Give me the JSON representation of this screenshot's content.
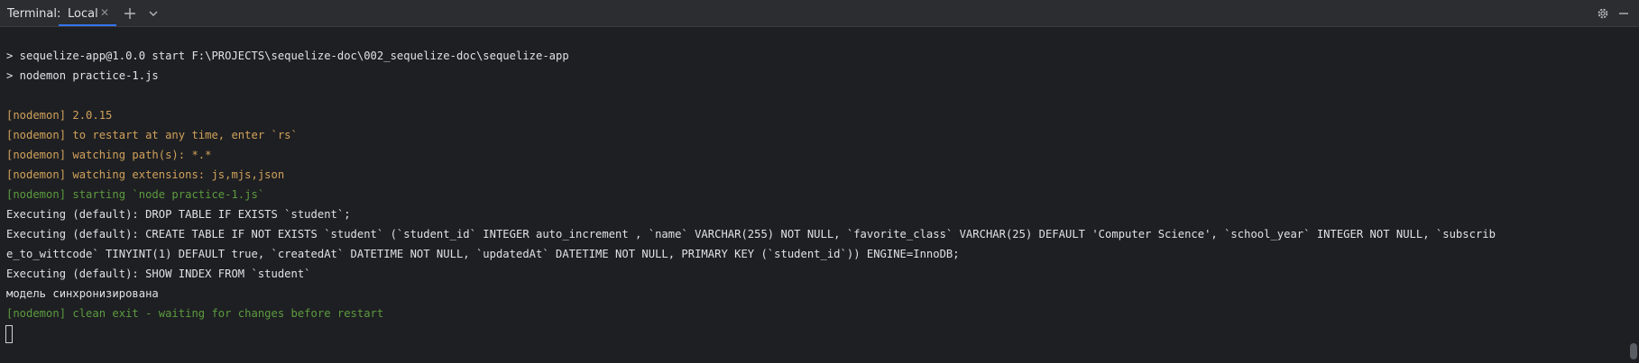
{
  "toolwindow": {
    "title": "Terminal:",
    "tab_label": "Local",
    "close_glyph": "✕",
    "icons": [
      "add-icon",
      "chevron-down-icon",
      "gear-icon",
      "minimize-icon"
    ]
  },
  "terminal": {
    "lines": [
      {
        "text": "> sequelize-app@1.0.0 start F:\\PROJECTS\\sequelize-doc\\002_sequelize-doc\\sequelize-app",
        "color": "default"
      },
      {
        "text": "> nodemon practice-1.js",
        "color": "default"
      },
      {
        "text": "[nodemon] 2.0.15",
        "color": "yellow"
      },
      {
        "text": "[nodemon] to restart at any time, enter `rs`",
        "color": "yellow"
      },
      {
        "text": "[nodemon] watching path(s): *.*",
        "color": "yellow"
      },
      {
        "text": "[nodemon] watching extensions: js,mjs,json",
        "color": "yellow"
      },
      {
        "text": "[nodemon] starting `node practice-1.js`",
        "color": "green"
      },
      {
        "text": "Executing (default): DROP TABLE IF EXISTS `student`;",
        "color": "default"
      },
      {
        "text": "Executing (default): CREATE TABLE IF NOT EXISTS `student` (`student_id` INTEGER auto_increment , `name` VARCHAR(255) NOT NULL, `favorite_class` VARCHAR(25) DEFAULT 'Computer Science', `school_year` INTEGER NOT NULL, `subscrib",
        "color": "default"
      },
      {
        "text": "e_to_wittcode` TINYINT(1) DEFAULT true, `createdAt` DATETIME NOT NULL, `updatedAt` DATETIME NOT NULL, PRIMARY KEY (`student_id`)) ENGINE=InnoDB;",
        "color": "default"
      },
      {
        "text": "Executing (default): SHOW INDEX FROM `student`",
        "color": "default"
      },
      {
        "text": "модель синхронизирована",
        "color": "default"
      },
      {
        "text": "[nodemon] clean exit - waiting for changes before restart",
        "color": "green"
      }
    ],
    "colors": {
      "default": "#dfe1e5",
      "yellow": "#d0a15b",
      "green": "#5c9b3f",
      "background": "#1e1f22",
      "accent": "#3574f0"
    }
  }
}
